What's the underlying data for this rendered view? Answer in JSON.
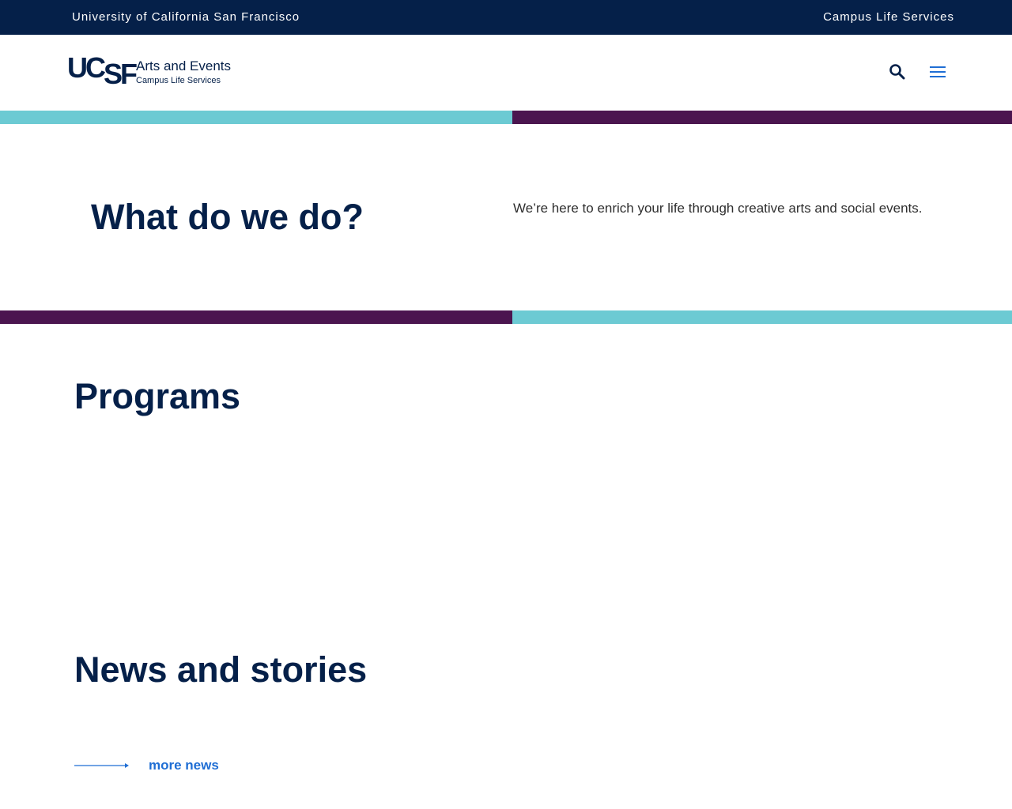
{
  "topbar": {
    "university": "University of California San Francisco",
    "campus_life": "Campus Life Services"
  },
  "header": {
    "logo": {
      "mark_uc": "UC",
      "mark_sf": "SF",
      "title": "Arts and Events",
      "subtitle": "Campus Life Services"
    },
    "search_icon": "search-icon",
    "menu_icon": "hamburger-menu-icon"
  },
  "intro": {
    "title": "What do we do?",
    "text": "We’re here to enrich your life through creative arts and social events."
  },
  "programs": {
    "title": "Programs"
  },
  "news": {
    "title": "News and stories",
    "more_label": "more news"
  },
  "colors": {
    "navy": "#052049",
    "teal": "#6ccad3",
    "plum": "#4b154f",
    "link": "#1f6ed4"
  }
}
